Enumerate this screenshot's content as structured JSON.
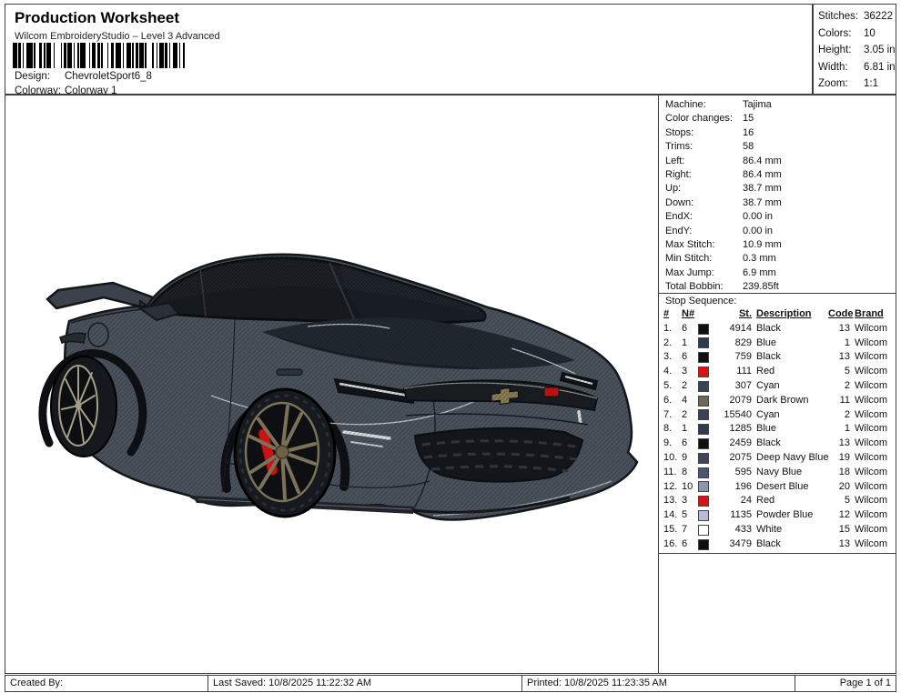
{
  "header": {
    "title": "Production Worksheet",
    "subtitle": "Wilcom EmbroideryStudio – Level 3 Advanced",
    "design_label": "Design:",
    "design_value": "ChevroletSport6_8",
    "colorway_label": "Colorway:",
    "colorway_value": "Colorway 1"
  },
  "summary": {
    "rows": [
      {
        "label": "Stitches:",
        "value": "36222"
      },
      {
        "label": "Colors:",
        "value": "10"
      },
      {
        "label": "Height:",
        "value": "3.05 in"
      },
      {
        "label": "Width:",
        "value": "6.81 in"
      },
      {
        "label": "Zoom:",
        "value": "1:1"
      }
    ]
  },
  "machine_info": {
    "rows": [
      {
        "label": "Machine:",
        "value": "Tajima"
      },
      {
        "label": "Color changes:",
        "value": "15"
      },
      {
        "label": "Stops:",
        "value": "16"
      },
      {
        "label": "Trims:",
        "value": "58"
      },
      {
        "label": "Left:",
        "value": "86.4 mm"
      },
      {
        "label": "Right:",
        "value": "86.4 mm"
      },
      {
        "label": "Up:",
        "value": "38.7 mm"
      },
      {
        "label": "Down:",
        "value": "38.7 mm"
      },
      {
        "label": "EndX:",
        "value": "0.00 in"
      },
      {
        "label": "EndY:",
        "value": "0.00 in"
      },
      {
        "label": "Max Stitch:",
        "value": "10.9 mm"
      },
      {
        "label": "Min Stitch:",
        "value": "0.3 mm"
      },
      {
        "label": "Max Jump:",
        "value": "6.9 mm"
      },
      {
        "label": "Total Bobbin:",
        "value": "239.85ft"
      }
    ]
  },
  "stop_sequence": {
    "title": "Stop Sequence:",
    "columns": {
      "num": "#",
      "n": "N#",
      "st": "St.",
      "description": "Description",
      "code": "Code",
      "brand": "Brand"
    },
    "rows": [
      {
        "num": "1.",
        "n": "6",
        "swatch": "#101010",
        "st": "4914",
        "description": "Black",
        "code": "13",
        "brand": "Wilcom"
      },
      {
        "num": "2.",
        "n": "1",
        "swatch": "#2f3a4d",
        "st": "829",
        "description": "Blue",
        "code": "1",
        "brand": "Wilcom"
      },
      {
        "num": "3.",
        "n": "6",
        "swatch": "#101010",
        "st": "759",
        "description": "Black",
        "code": "13",
        "brand": "Wilcom"
      },
      {
        "num": "4.",
        "n": "3",
        "swatch": "#dd1212",
        "st": "111",
        "description": "Red",
        "code": "5",
        "brand": "Wilcom"
      },
      {
        "num": "5.",
        "n": "2",
        "swatch": "#3a4355",
        "st": "307",
        "description": "Cyan",
        "code": "2",
        "brand": "Wilcom"
      },
      {
        "num": "6.",
        "n": "4",
        "swatch": "#6d685a",
        "st": "2079",
        "description": "Dark Brown",
        "code": "11",
        "brand": "Wilcom"
      },
      {
        "num": "7.",
        "n": "2",
        "swatch": "#3a4355",
        "st": "15540",
        "description": "Cyan",
        "code": "2",
        "brand": "Wilcom"
      },
      {
        "num": "8.",
        "n": "1",
        "swatch": "#2f3a4d",
        "st": "1285",
        "description": "Blue",
        "code": "1",
        "brand": "Wilcom"
      },
      {
        "num": "9.",
        "n": "6",
        "swatch": "#101010",
        "st": "2459",
        "description": "Black",
        "code": "13",
        "brand": "Wilcom"
      },
      {
        "num": "10.",
        "n": "9",
        "swatch": "#3e4655",
        "st": "2075",
        "description": "Deep Navy Blue",
        "code": "19",
        "brand": "Wilcom"
      },
      {
        "num": "11.",
        "n": "8",
        "swatch": "#4b5470",
        "st": "595",
        "description": "Navy Blue",
        "code": "18",
        "brand": "Wilcom"
      },
      {
        "num": "12.",
        "n": "10",
        "swatch": "#8c94ae",
        "st": "196",
        "description": "Desert Blue",
        "code": "20",
        "brand": "Wilcom"
      },
      {
        "num": "13.",
        "n": "3",
        "swatch": "#dd1212",
        "st": "24",
        "description": "Red",
        "code": "5",
        "brand": "Wilcom"
      },
      {
        "num": "14.",
        "n": "5",
        "swatch": "#b7bcdb",
        "st": "1135",
        "description": "Powder Blue",
        "code": "12",
        "brand": "Wilcom"
      },
      {
        "num": "15.",
        "n": "7",
        "swatch": "#ffffff",
        "st": "433",
        "description": "White",
        "code": "15",
        "brand": "Wilcom"
      },
      {
        "num": "16.",
        "n": "6",
        "swatch": "#101010",
        "st": "3479",
        "description": "Black",
        "code": "13",
        "brand": "Wilcom"
      }
    ]
  },
  "design_preview": {
    "name": "ChevroletSport6_8 embroidery preview",
    "colors": {
      "body": "#49515b",
      "body_dark": "#3b424b",
      "outline": "#14171a",
      "glass": "#161a1f",
      "hood": "#21272f",
      "grille": "#181c21",
      "mesh": "#13161b",
      "wheel_front": "#7c7258",
      "wheel_rear": "#a49e88",
      "caliper": "#c81414",
      "badge_red": "#c41212",
      "emblem_gold": "#8a7a52",
      "highlight": "#d8dcdf"
    }
  },
  "footer": {
    "created_by": "Created By:",
    "last_saved": "Last Saved: 10/8/2025 11:22:32 AM",
    "printed": "Printed: 10/8/2025 11:23:35 AM",
    "page": "Page 1 of 1"
  }
}
